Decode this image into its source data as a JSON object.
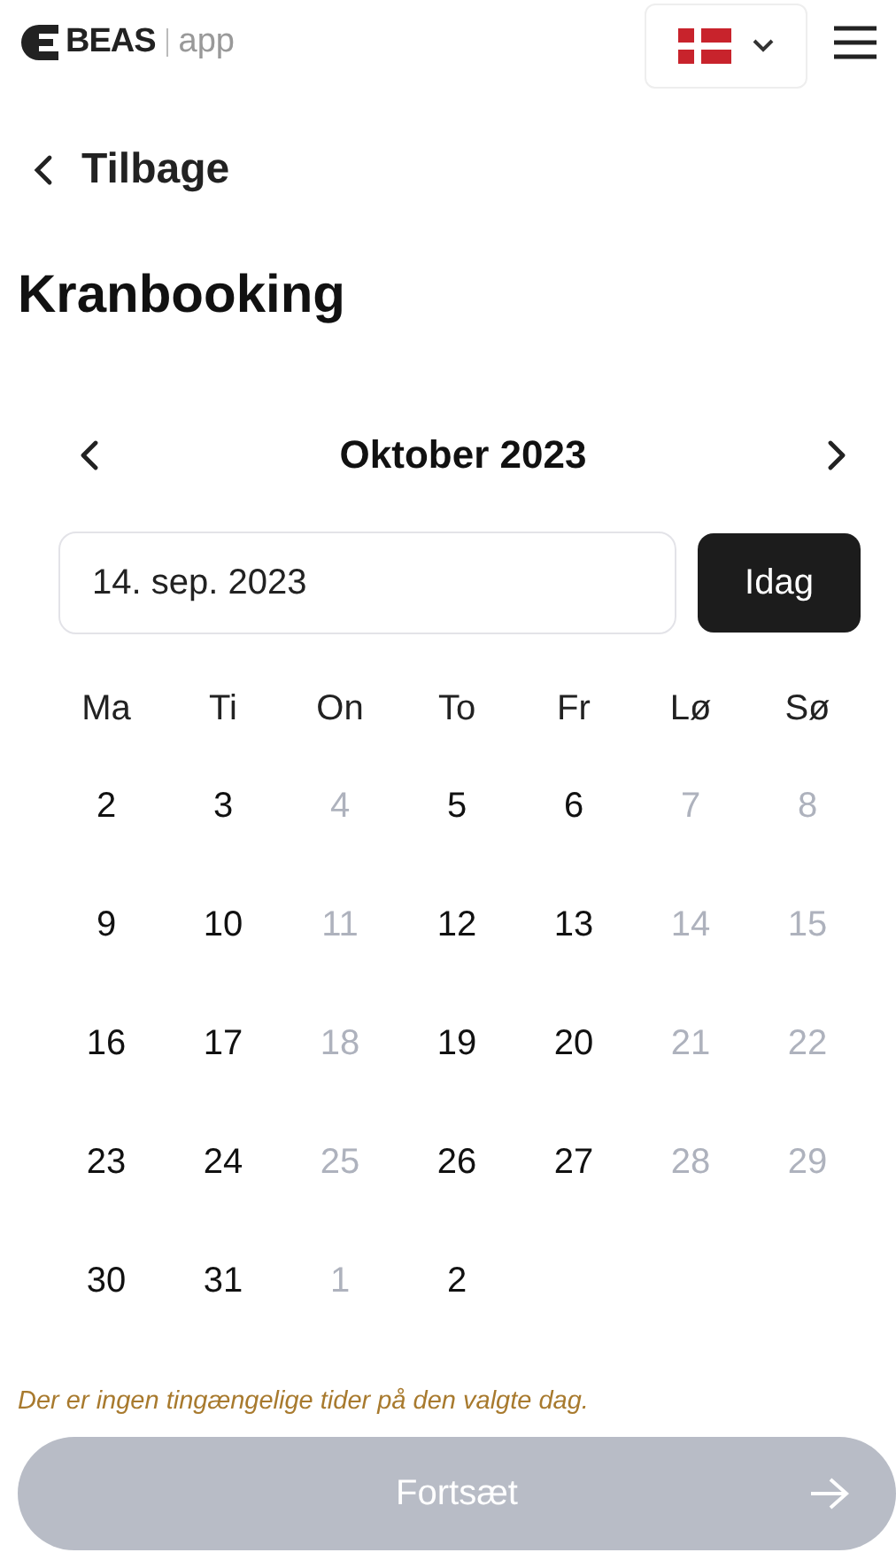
{
  "header": {
    "logo_text": "BEAS",
    "logo_suffix": "app"
  },
  "back_link": {
    "label": "Tilbage"
  },
  "title": "Kranbooking",
  "calendar": {
    "month": "Oktober 2023",
    "date_field": {
      "value": "14. sep. 2023"
    },
    "today_button": "Idag",
    "weekdays": [
      "Ma",
      "Ti",
      "On",
      "To",
      "Fr",
      "Lø",
      "Sø"
    ],
    "weeks": [
      [
        {
          "day": "2",
          "disabled": false
        },
        {
          "day": "3",
          "disabled": false
        },
        {
          "day": "4",
          "disabled": true
        },
        {
          "day": "5",
          "disabled": false
        },
        {
          "day": "6",
          "disabled": false
        },
        {
          "day": "7",
          "disabled": true
        },
        {
          "day": "8",
          "disabled": true
        }
      ],
      [
        {
          "day": "9",
          "disabled": false
        },
        {
          "day": "10",
          "disabled": false
        },
        {
          "day": "11",
          "disabled": true
        },
        {
          "day": "12",
          "disabled": false
        },
        {
          "day": "13",
          "disabled": false
        },
        {
          "day": "14",
          "disabled": true
        },
        {
          "day": "15",
          "disabled": true
        }
      ],
      [
        {
          "day": "16",
          "disabled": false
        },
        {
          "day": "17",
          "disabled": false
        },
        {
          "day": "18",
          "disabled": true
        },
        {
          "day": "19",
          "disabled": false
        },
        {
          "day": "20",
          "disabled": false
        },
        {
          "day": "21",
          "disabled": true
        },
        {
          "day": "22",
          "disabled": true
        }
      ],
      [
        {
          "day": "23",
          "disabled": false
        },
        {
          "day": "24",
          "disabled": false
        },
        {
          "day": "25",
          "disabled": true
        },
        {
          "day": "26",
          "disabled": false
        },
        {
          "day": "27",
          "disabled": false
        },
        {
          "day": "28",
          "disabled": true
        },
        {
          "day": "29",
          "disabled": true
        }
      ],
      [
        {
          "day": "30",
          "disabled": false
        },
        {
          "day": "31",
          "disabled": false
        },
        {
          "day": "1",
          "disabled": true
        },
        {
          "day": "2",
          "disabled": false
        }
      ]
    ]
  },
  "message": "Der er ingen tingængelige tider på den valgte dag.",
  "continue_button": {
    "label": "Fortsæt",
    "disabled": true
  }
}
